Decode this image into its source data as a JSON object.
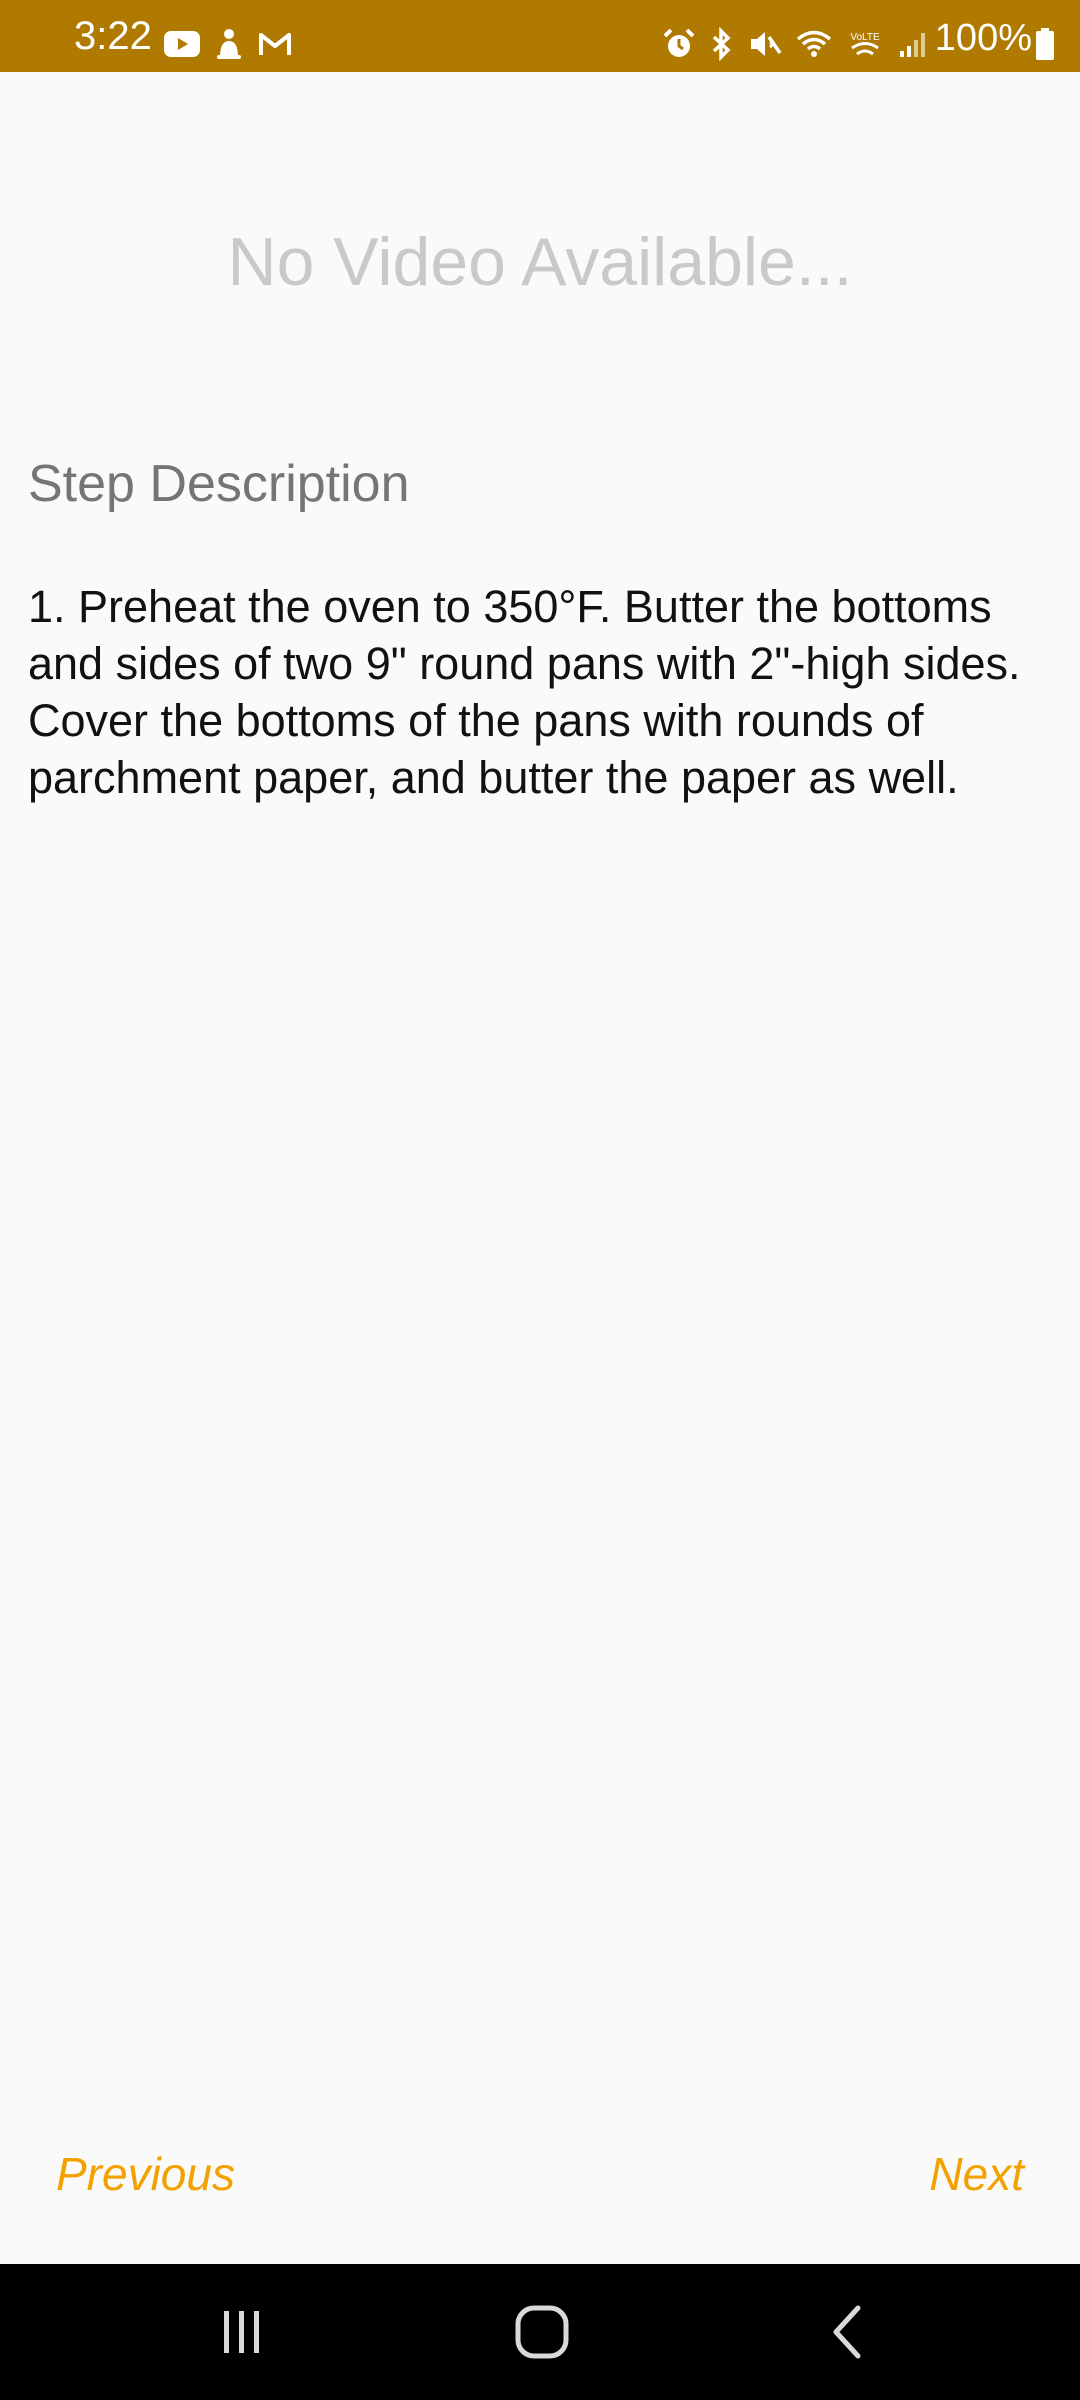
{
  "status_bar": {
    "time": "3:22",
    "battery": "100%",
    "background": "#b07900",
    "left_icons": [
      "youtube-icon",
      "notification-icon",
      "gmail-icon"
    ],
    "right_icons": [
      "alarm-icon",
      "bluetooth-icon",
      "mute-icon",
      "wifi-icon",
      "volte-icon",
      "signal-icon"
    ]
  },
  "video": {
    "placeholder_text": "No Video Available..."
  },
  "step": {
    "heading": "Step Description",
    "text": "1. Preheat the oven to 350°F. Butter the bottoms and sides of two 9\" round pans with 2\"-high sides. Cover the bottoms of the pans with rounds of parchment paper, and butter the paper as well."
  },
  "navigation": {
    "previous_label": "Previous",
    "next_label": "Next",
    "accent": "#f2a100"
  },
  "system_nav": {
    "icons": [
      "recents-icon",
      "home-icon",
      "back-icon"
    ]
  }
}
